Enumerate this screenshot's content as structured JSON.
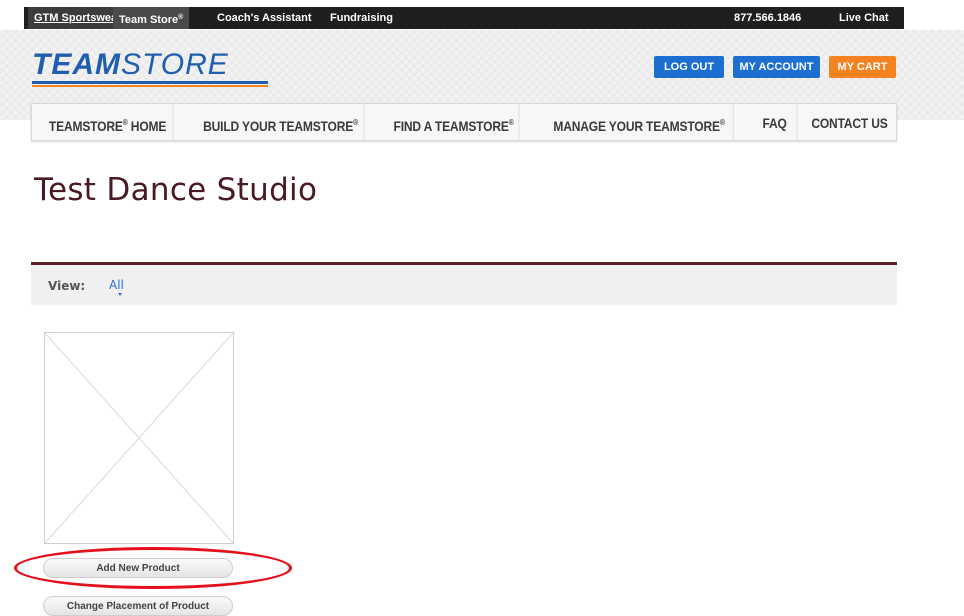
{
  "topbar": {
    "gtm": "GTM Sportswear",
    "teamstore": "Team Store",
    "teamstore_mark": "®",
    "coach": "Coach's Assistant",
    "fundraising": "Fundraising",
    "phone": "877.566.1846",
    "live_chat": "Live Chat"
  },
  "header": {
    "logo_bold": "TEAM",
    "logo_thin": "STORE",
    "logout": "LOG OUT",
    "my_account": "MY ACCOUNT",
    "my_cart": "MY CART"
  },
  "nav": {
    "home": "TEAMSTORE",
    "build": "BUILD YOUR TEAMSTORE",
    "find": "FIND A TEAMSTORE",
    "manage": "MANAGE YOUR TEAMSTORE",
    "faq": "FAQ",
    "contact": "CONTACT US",
    "home_suffix": " HOME",
    "reg": "®"
  },
  "page": {
    "title": "Test Dance Studio"
  },
  "view": {
    "label": "View:",
    "value": "All"
  },
  "product": {
    "add_new": "Add New Product",
    "change_placement": "Change Placement of Product"
  },
  "colors": {
    "title": "#4a1a22",
    "divider": "#5a2128",
    "blue_button": "#1c6fd0",
    "cart_button": "#f58220",
    "highlight": "#e4101b"
  }
}
